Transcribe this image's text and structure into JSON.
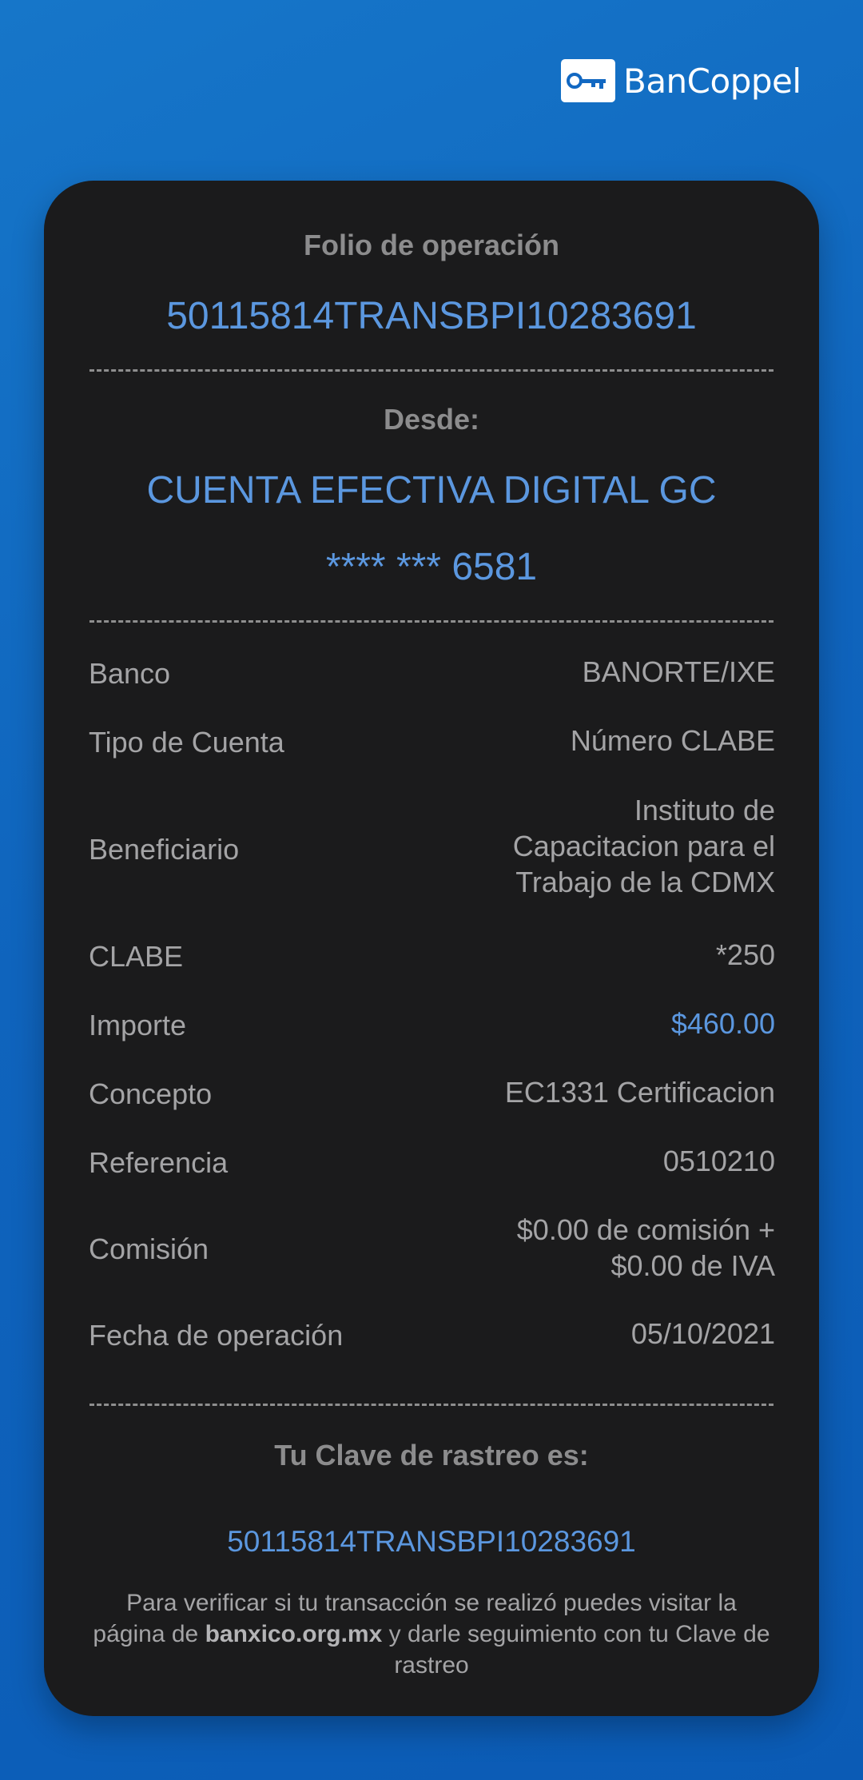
{
  "brand": {
    "name": "BanCoppel",
    "icon": "key-icon",
    "colors": {
      "background": "#0f64bd",
      "card": "#1b1b1c",
      "accent": "#5b97df",
      "text": "#a4a4a6"
    }
  },
  "receipt": {
    "folio_label": "Folio de operación",
    "folio_value": "50115814TRANSBPI10283691",
    "desde_label": "Desde:",
    "account_name": "CUENTA EFECTIVA DIGITAL GC",
    "account_number": "**** *** 6581",
    "details": [
      {
        "label": "Banco",
        "value": [
          "BANORTE/IXE"
        ]
      },
      {
        "label": "Tipo de Cuenta",
        "value": [
          "Número CLABE"
        ]
      },
      {
        "label": "Beneficiario",
        "value": [
          "Instituto de",
          "Capacitacion para el",
          "Trabajo de la CDMX"
        ]
      },
      {
        "label": "CLABE",
        "value": [
          "*250"
        ]
      },
      {
        "label": "Importe",
        "value": [
          "$460.00"
        ],
        "highlight": true
      },
      {
        "label": "Concepto",
        "value": [
          "EC1331 Certificacion"
        ]
      },
      {
        "label": "Referencia",
        "value": [
          "0510210"
        ]
      },
      {
        "label": "Comisión",
        "value": [
          "$0.00 de comisión +",
          "$0.00 de IVA"
        ]
      },
      {
        "label": "Fecha de operación",
        "value": [
          "05/10/2021"
        ]
      }
    ],
    "clave_label": "Tu Clave de rastreo es:",
    "clave_value": "50115814TRANSBPI10283691",
    "note": {
      "part1": "Para verificar si tu transacción se realizó puedes visitar la página de ",
      "link": "banxico.org.mx",
      "part2": " y darle seguimiento con tu Clave de rastreo"
    }
  }
}
